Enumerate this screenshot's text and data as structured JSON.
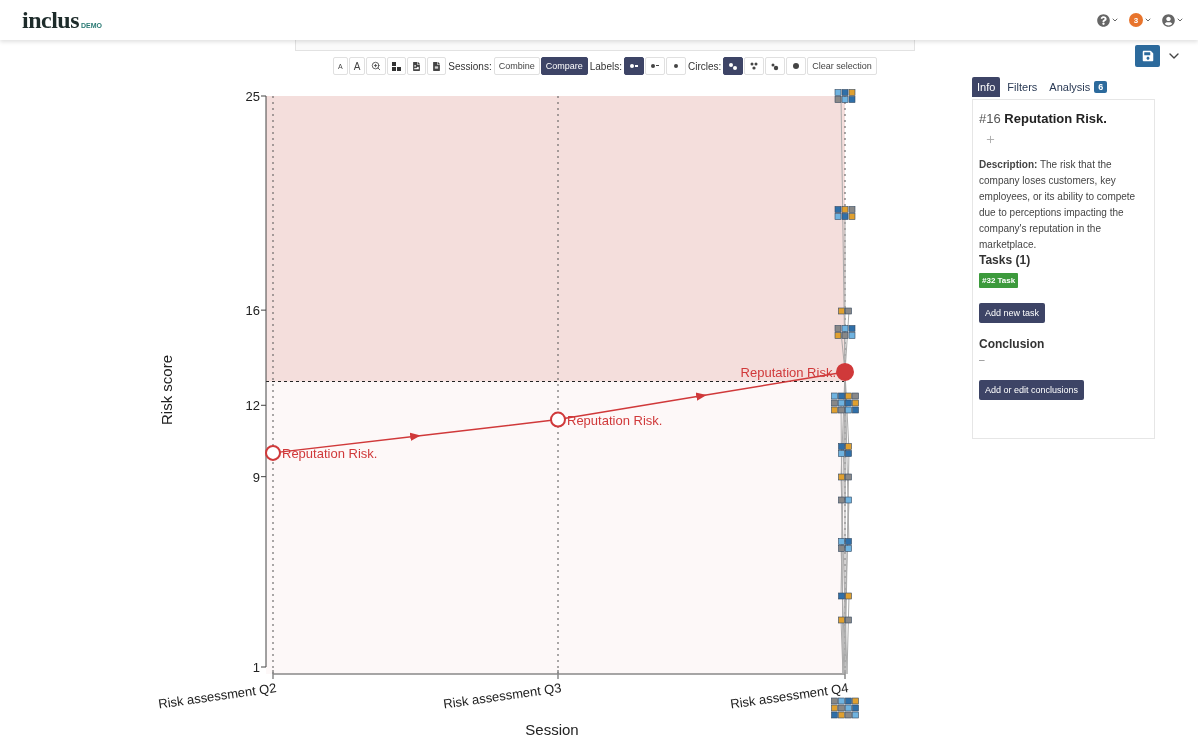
{
  "header": {
    "logo": "inclus",
    "logo_badge": "DEMO",
    "notification_count": "3"
  },
  "toolbar": {
    "font_buttons": [
      "A",
      "A"
    ],
    "sessions": {
      "label": "Sessions:",
      "options": [
        {
          "label": "Combine",
          "selected": false
        },
        {
          "label": "Compare",
          "selected": true
        }
      ]
    },
    "labels": {
      "label": "Labels:",
      "options": [
        {
          "selected": true
        },
        {
          "selected": false
        },
        {
          "selected": false
        }
      ]
    },
    "circles": {
      "label": "Circles:",
      "options": [
        {
          "selected": true
        },
        {
          "selected": false
        },
        {
          "selected": false
        },
        {
          "selected": false
        }
      ]
    },
    "clear_button": "Clear selection"
  },
  "chart": {
    "chart_data": {
      "type": "line",
      "xlabel": "Session",
      "ylabel": "Risk score",
      "categories": [
        "Risk assessment Q2",
        "Risk assessment Q3",
        "Risk assessment Q4"
      ],
      "series": [
        {
          "name": "Reputation Risk.",
          "color": "#d0393a",
          "marker": "circle",
          "values": [
            10,
            11.4,
            13.4
          ]
        }
      ],
      "ylim": [
        1,
        25
      ],
      "yticks": [
        1,
        9,
        12,
        16,
        25
      ],
      "ref_lines": [
        {
          "axis": "y",
          "value": 13
        },
        {
          "axis": "x",
          "value": "Risk assessment Q2"
        },
        {
          "axis": "x",
          "value": "Risk assessment Q3"
        },
        {
          "axis": "x",
          "value": "Risk assessment Q4"
        }
      ]
    },
    "points": [
      {
        "filled": false
      },
      {
        "filled": false
      },
      {
        "filled": true
      }
    ]
  },
  "sidebar": {
    "tabs": [
      {
        "label": "Info",
        "selected": true
      },
      {
        "label": "Filters",
        "selected": false
      },
      {
        "label": "Analysis",
        "badge": "6",
        "selected": false
      }
    ],
    "card": {
      "id": "#16",
      "title": "Reputation Risk.",
      "description": "**Description:** The risk that the company loses customers, key employees, or its ability to compete due to perceptions impacting the company's reputation in the marketplace.",
      "tasks_heading": "Tasks (1)",
      "tasks": [
        "#32 Task"
      ],
      "add_task_button": "Add new task",
      "conclusion_heading": "Conclusion",
      "conclusion": "–",
      "conclusion_button": "Add or edit conclusions"
    }
  }
}
